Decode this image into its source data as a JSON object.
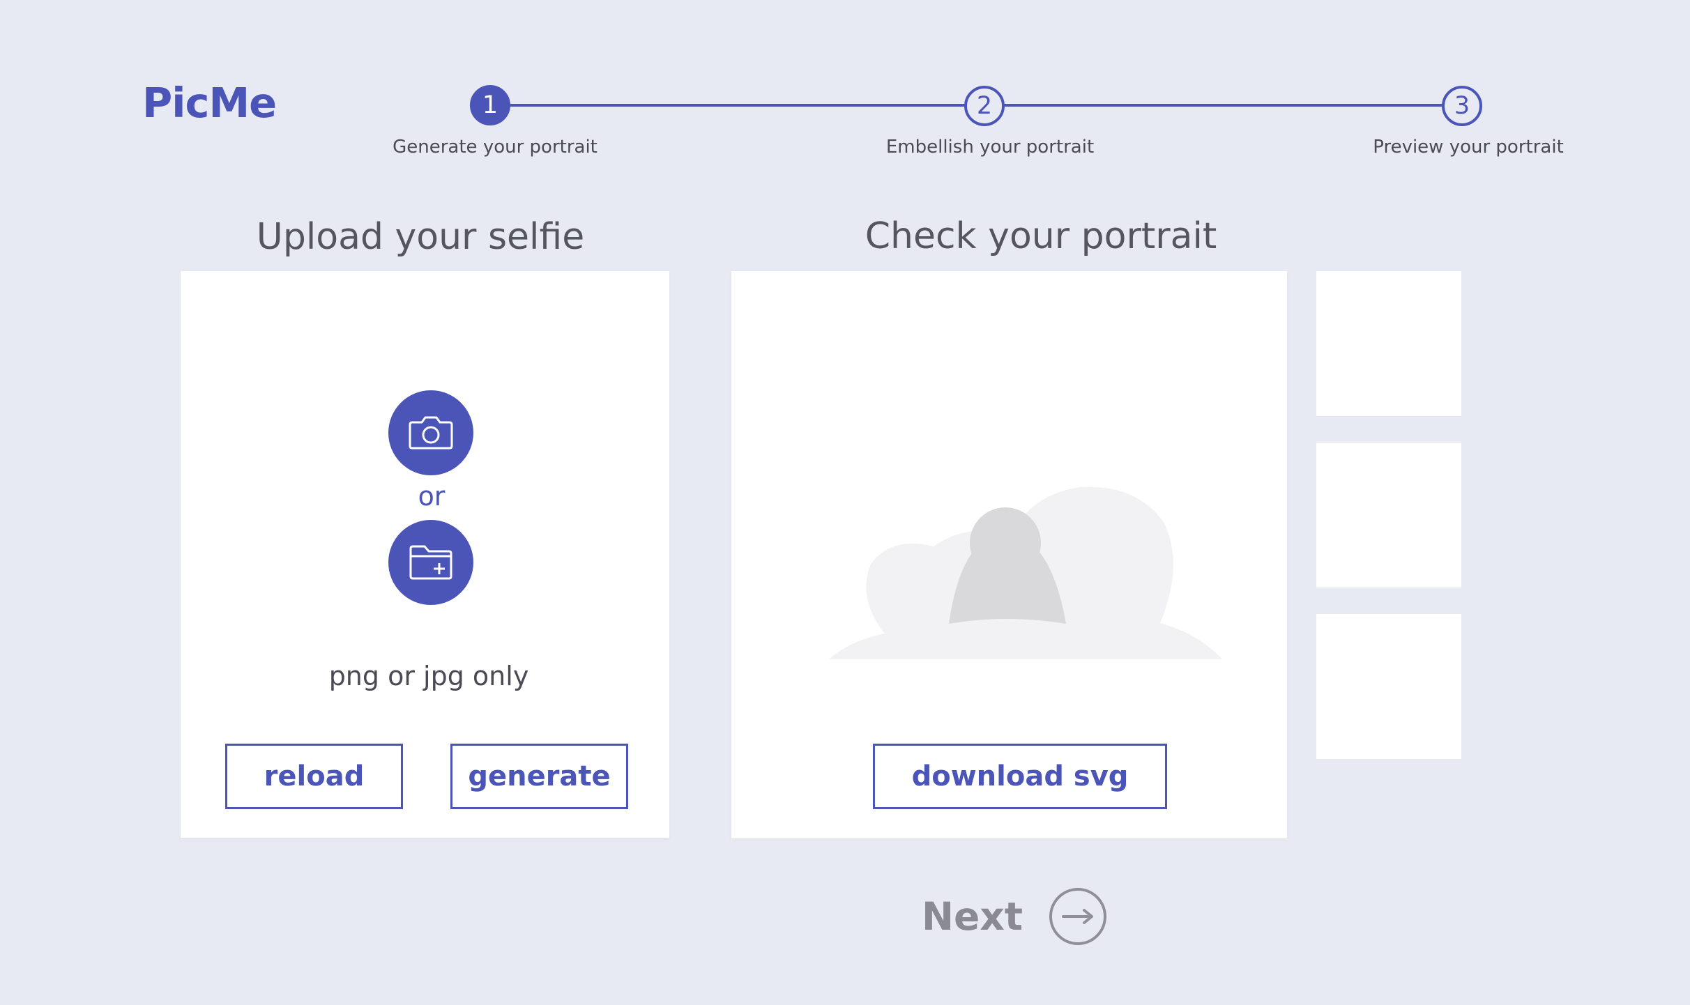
{
  "brand": {
    "name": "PicMe",
    "accent_color": "#4b55b8",
    "background_color": "#e8eaf3"
  },
  "stepper": {
    "current_step": 1,
    "steps": [
      {
        "number": "1",
        "label": "Generate your portrait",
        "state": "active"
      },
      {
        "number": "2",
        "label": "Embellish your portrait",
        "state": "inactive"
      },
      {
        "number": "3",
        "label": "Preview your portrait",
        "state": "inactive"
      }
    ]
  },
  "upload": {
    "title": "Upload your selfie",
    "camera_icon": "camera-icon",
    "or_label": "or",
    "folder_icon": "folder-add-icon",
    "hint": "png or jpg only",
    "reload_label": "reload",
    "generate_label": "generate"
  },
  "portrait": {
    "title": "Check your portrait",
    "placeholder_icon": "person-placeholder-icon",
    "download_label": "download svg",
    "thumbnail_count": 3
  },
  "navigation": {
    "next_label": "Next",
    "next_icon": "arrow-right-icon"
  }
}
